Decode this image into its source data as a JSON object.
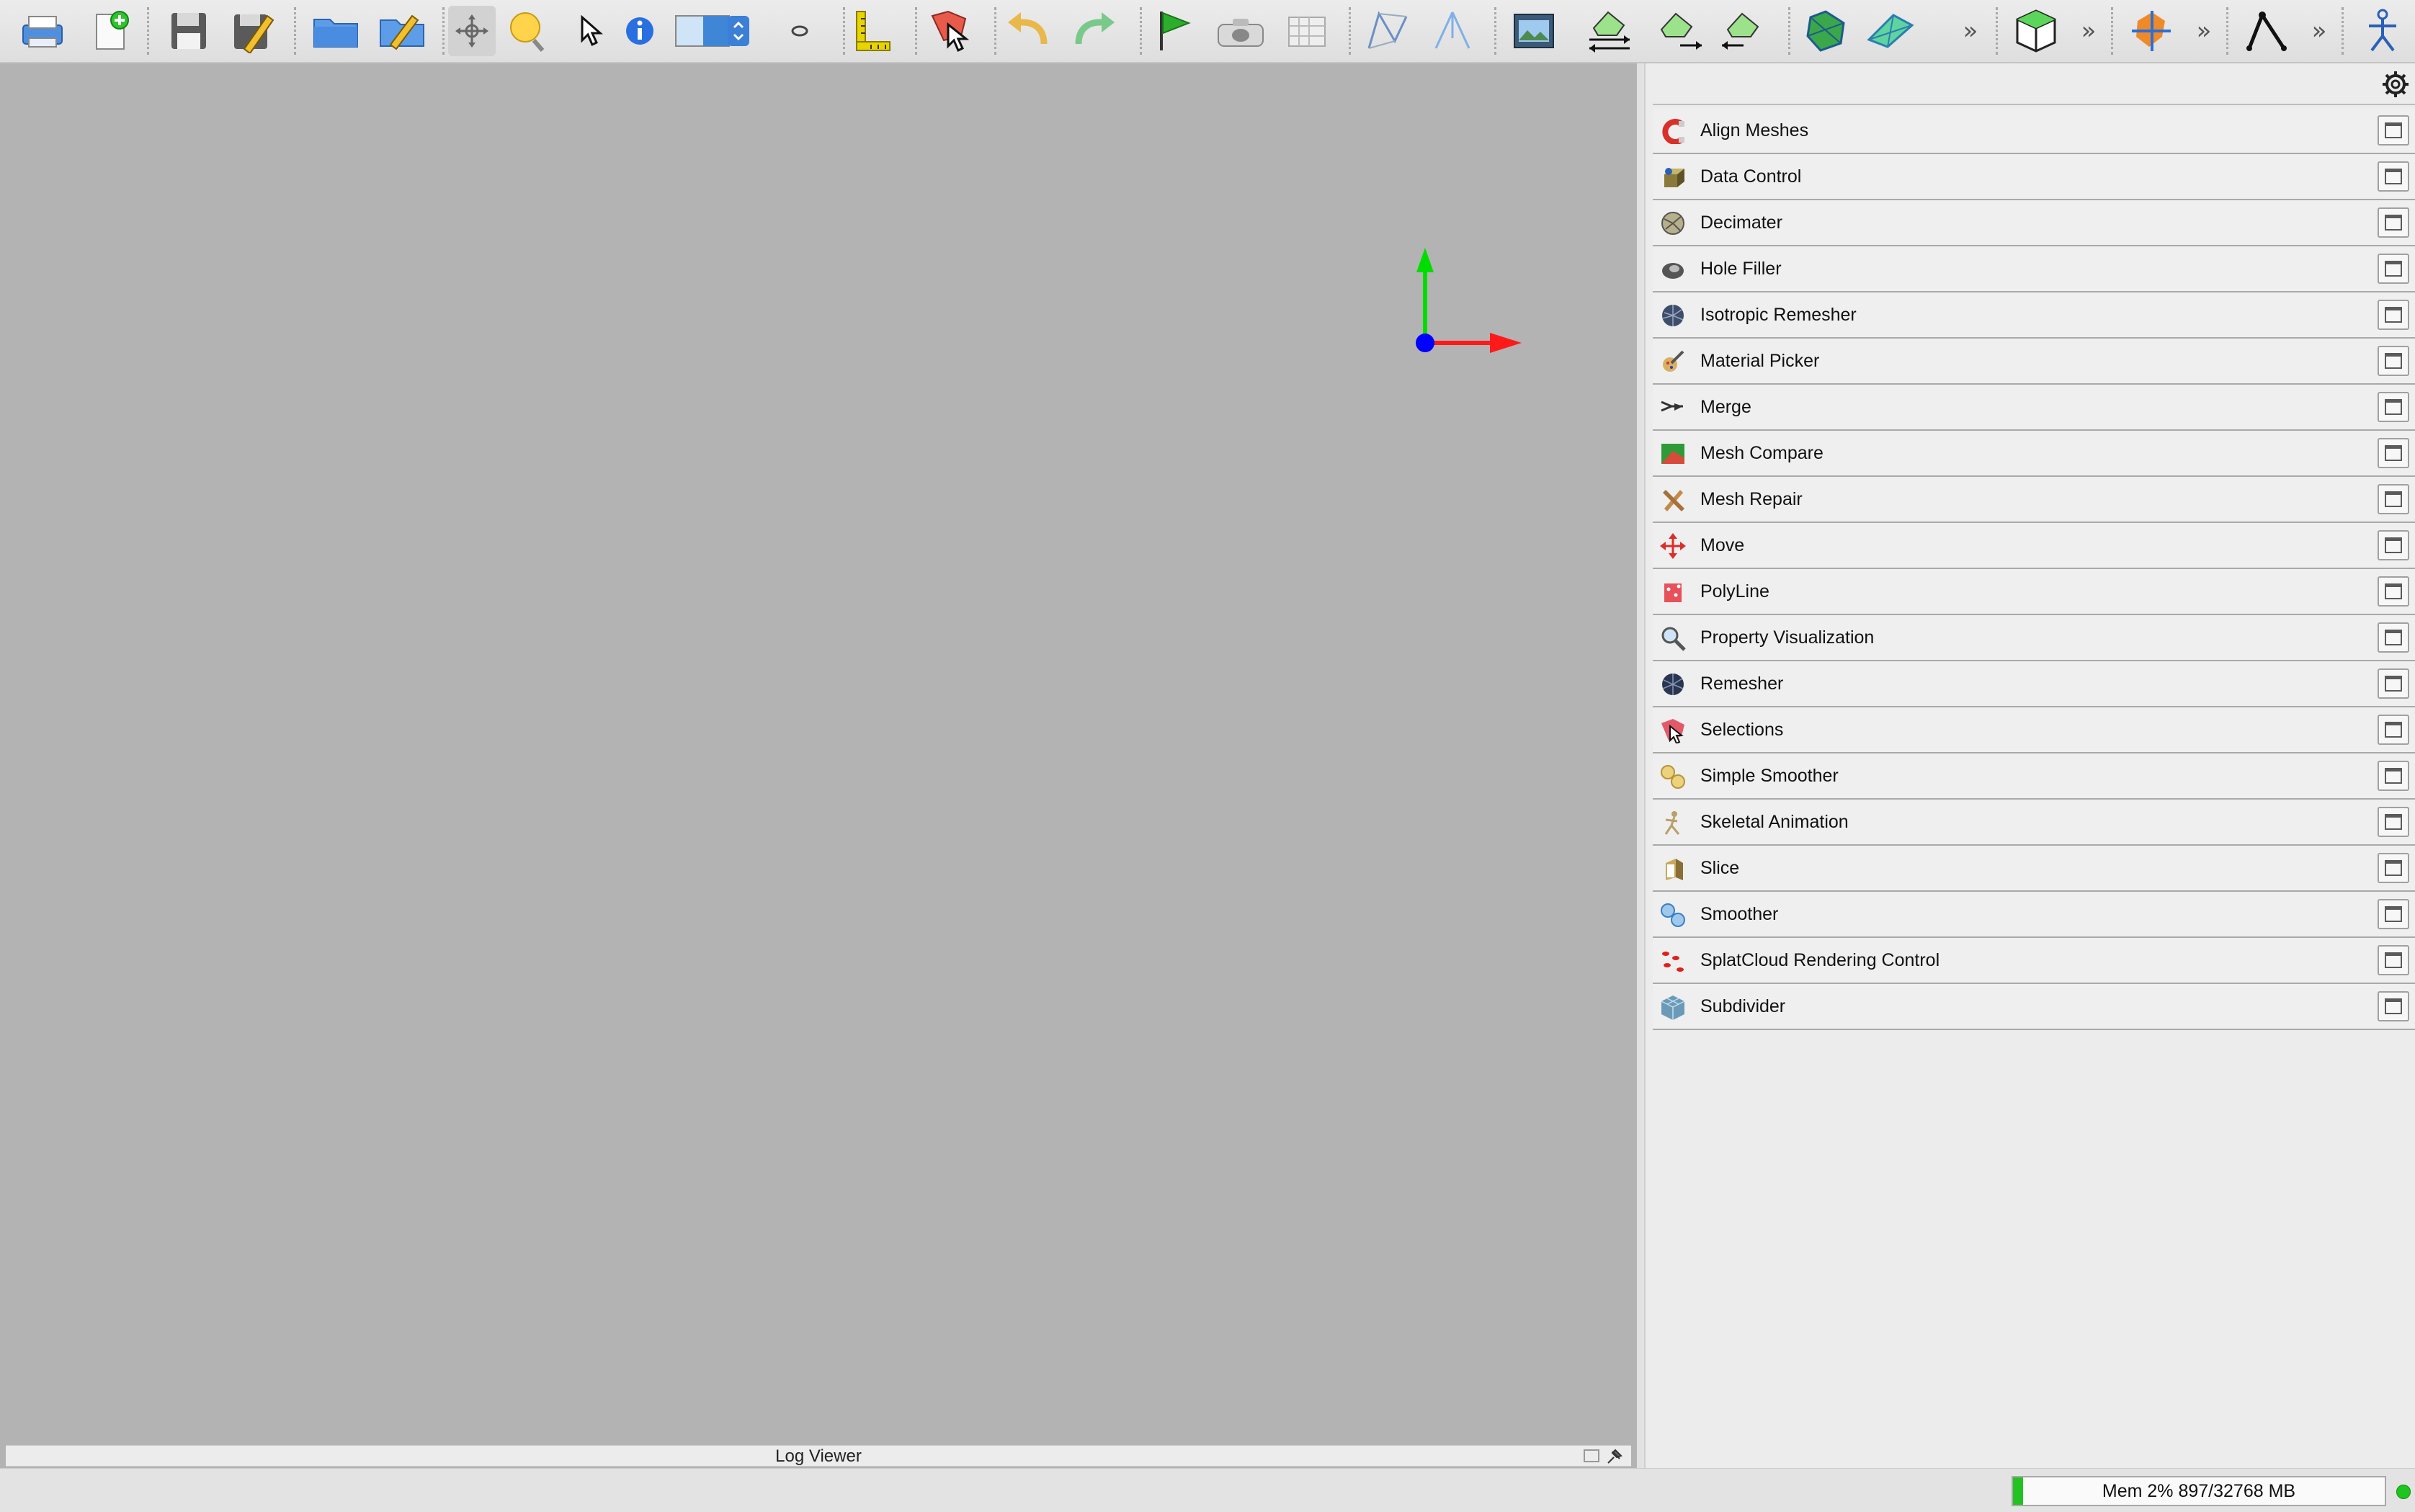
{
  "toolbar": {
    "icons": [
      "print-icon",
      "new-document-icon",
      "save-icon",
      "save-as-icon",
      "open-folder-icon",
      "open-recent-icon",
      "move-mode-icon",
      "light-mode-icon",
      "pick-mode-icon",
      "info-icon",
      "viewport-toggle-icon",
      "visibility-icon",
      "ruler-icon",
      "selection-tool-icon",
      "undo-icon",
      "redo-icon",
      "flag-icon",
      "snapshot-icon",
      "grid-icon",
      "wireframe-icon",
      "tetrahedron-icon",
      "screenshot-icon",
      "mesh-import-icon",
      "mesh-export-icon",
      "mesh-add-icon",
      "sphere-mesh-icon",
      "plane-mesh-icon",
      "box-mesh-icon",
      "transform-icon",
      "skeleton-icon",
      "stick-figure-icon"
    ],
    "overflow_label": "»"
  },
  "viewer": {
    "axes": {
      "y_color": "#00dd00",
      "x_color": "#ff1a1a",
      "origin_color": "#0000ff"
    }
  },
  "log_viewer": {
    "title": "Log Viewer"
  },
  "toolbox": {
    "items": [
      {
        "label": "Align Meshes",
        "icon": "magnet-icon"
      },
      {
        "label": "Data Control",
        "icon": "data-control-icon"
      },
      {
        "label": "Decimater",
        "icon": "decimater-icon"
      },
      {
        "label": "Hole Filler",
        "icon": "hole-filler-icon"
      },
      {
        "label": "Isotropic Remesher",
        "icon": "isotropic-remesher-icon"
      },
      {
        "label": "Material Picker",
        "icon": "material-picker-icon"
      },
      {
        "label": "Merge",
        "icon": "merge-icon"
      },
      {
        "label": "Mesh Compare",
        "icon": "mesh-compare-icon"
      },
      {
        "label": "Mesh Repair",
        "icon": "mesh-repair-icon"
      },
      {
        "label": "Move",
        "icon": "move-icon"
      },
      {
        "label": "PolyLine",
        "icon": "polyline-icon"
      },
      {
        "label": "Property Visualization",
        "icon": "magnifier-icon"
      },
      {
        "label": "Remesher",
        "icon": "remesher-icon"
      },
      {
        "label": "Selections",
        "icon": "selections-icon"
      },
      {
        "label": "Simple Smoother",
        "icon": "simple-smoother-icon"
      },
      {
        "label": "Skeletal Animation",
        "icon": "skeletal-animation-icon"
      },
      {
        "label": "Slice",
        "icon": "slice-icon"
      },
      {
        "label": "Smoother",
        "icon": "smoother-icon"
      },
      {
        "label": "SplatCloud Rendering Control",
        "icon": "splatcloud-icon"
      },
      {
        "label": "Subdivider",
        "icon": "subdivider-icon"
      }
    ]
  },
  "status": {
    "memory_text": "Mem 2% 897/32768 MB",
    "memory_fraction": 0.027,
    "led_color": "#1fc51f"
  }
}
